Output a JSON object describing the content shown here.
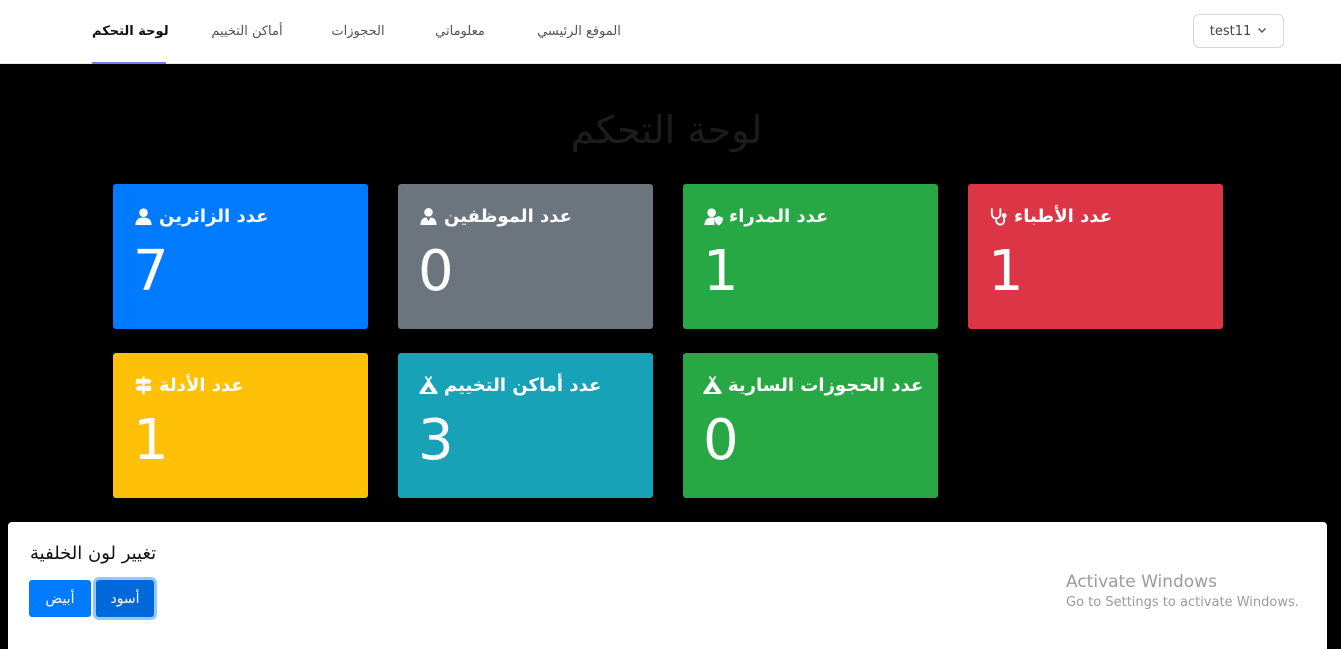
{
  "navbar": {
    "items": [
      {
        "label": "لوحة التحكم",
        "active": true
      },
      {
        "label": "أماكن التخييم",
        "active": false
      },
      {
        "label": "الحجوزات",
        "active": false
      },
      {
        "label": "معلوماتي",
        "active": false
      },
      {
        "label": "الموقع الرئيسي",
        "active": false
      }
    ],
    "user": {
      "label": "test11",
      "icon": "chevron-down-icon"
    }
  },
  "page": {
    "title": "لوحة التحكم"
  },
  "cards": [
    {
      "label": "عدد الزائرين",
      "value": "7",
      "icon": "user-icon",
      "color": "#007bff"
    },
    {
      "label": "عدد الموظفين",
      "value": "0",
      "icon": "user-tie-icon",
      "color": "#6c757d"
    },
    {
      "label": "عدد المدراء",
      "value": "1",
      "icon": "user-shield-icon",
      "color": "#28a745"
    },
    {
      "label": "عدد الأطباء",
      "value": "1",
      "icon": "stethoscope-icon",
      "color": "#dc3545"
    },
    {
      "label": "عدد الأدلة",
      "value": "1",
      "icon": "signs-post-icon",
      "color": "#ffc107"
    },
    {
      "label": "عدد أماكن التخييم",
      "value": "3",
      "icon": "campground-icon",
      "color": "#17a2b8"
    },
    {
      "label": "عدد الحجوزات السارية",
      "value": "0",
      "icon": "campground-icon",
      "color": "#28a745"
    }
  ],
  "background_panel": {
    "title": "تغيير لون الخلفية",
    "white_label": "أبيض",
    "black_label": "أسود"
  },
  "watermark": {
    "line1": "Activate Windows",
    "line2": "Go to Settings to activate Windows."
  }
}
